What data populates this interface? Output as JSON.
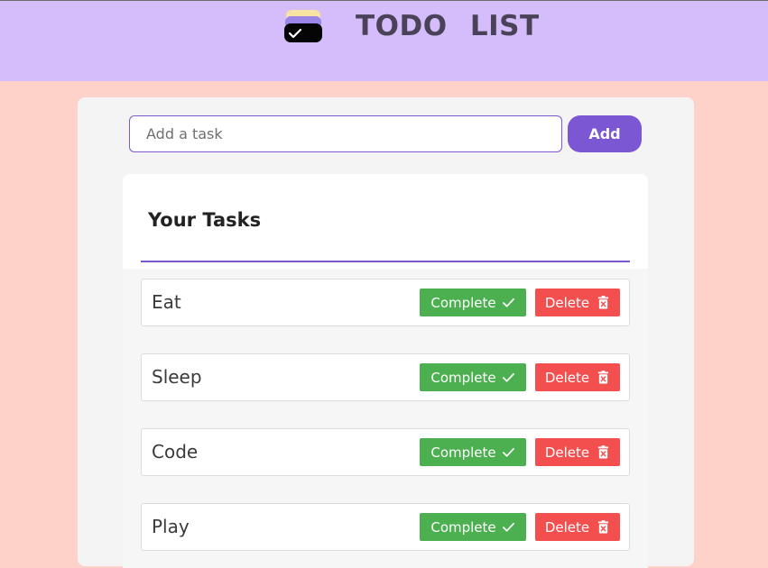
{
  "header": {
    "title": "TODO LIST",
    "logo_icon": "todo-check-logo-icon",
    "background": "#d5bdfb"
  },
  "input": {
    "placeholder": "Add a task",
    "value": ""
  },
  "add_button": {
    "label": "Add",
    "color": "#7b57d4"
  },
  "tasks_section": {
    "heading": "Your Tasks",
    "tasks": [
      {
        "text": "Eat",
        "complete_label": "Complete",
        "delete_label": "Delete"
      },
      {
        "text": "Sleep",
        "complete_label": "Complete",
        "delete_label": "Delete"
      },
      {
        "text": "Code",
        "complete_label": "Complete",
        "delete_label": "Delete"
      },
      {
        "text": "Play",
        "complete_label": "Complete",
        "delete_label": "Delete"
      }
    ]
  },
  "colors": {
    "page_background": "#ffd2c9",
    "complete": "#4caf50",
    "delete": "#f44f4f"
  },
  "icons": {
    "complete": "check-icon",
    "delete": "trash-icon"
  }
}
